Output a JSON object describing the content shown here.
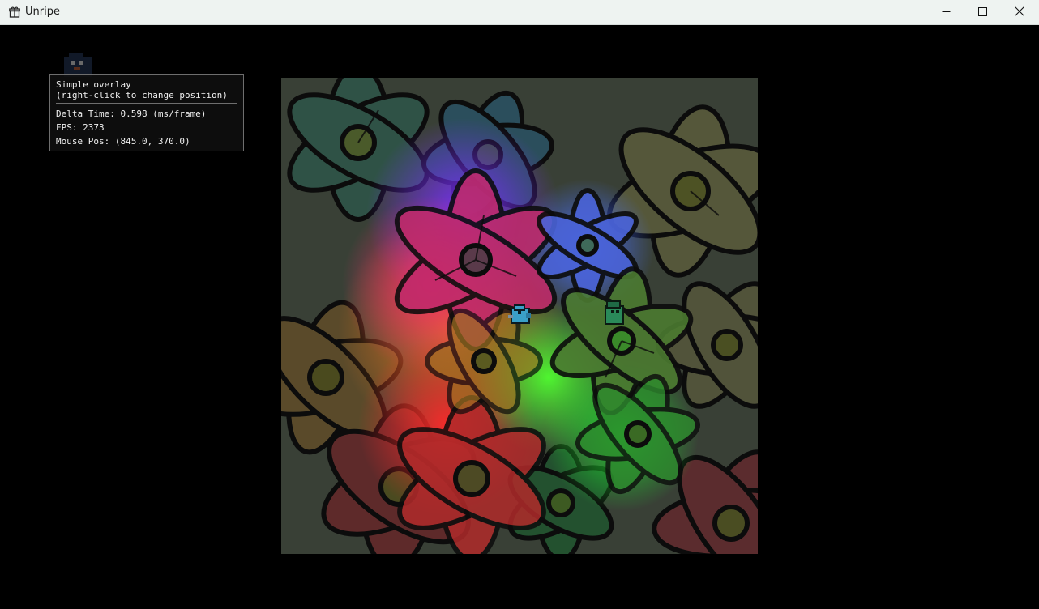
{
  "window": {
    "title": "Unripe",
    "app_icon": "gift-box-icon",
    "controls": {
      "minimize_icon": "minimize-icon",
      "maximize_icon": "maximize-icon",
      "close_icon": "close-icon"
    }
  },
  "overlay": {
    "title_line1": "Simple overlay",
    "title_line2": "(right-click to change position)",
    "delta_time": "Delta Time: 0.598 (ms/frame)",
    "fps": "FPS: 2373",
    "mouse_pos": "Mouse Pos: (845.0, 370.0)"
  },
  "scene": {
    "description_icon": "flower-field-scene",
    "sprites": [
      "blue-bird-sprite",
      "green-bird-sprite",
      "ghost-bird-sprite"
    ],
    "light_colors": [
      "#ff3030",
      "#ff2060",
      "#7a30ff",
      "#40ff30",
      "#3050ff",
      "#ff8020"
    ]
  }
}
